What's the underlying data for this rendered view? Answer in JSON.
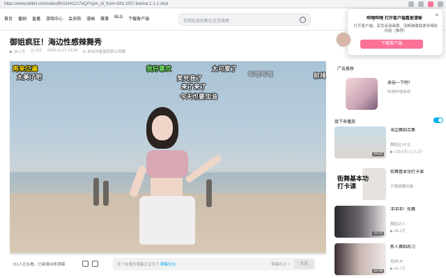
{
  "browser": {
    "url": "https://www.bilibili.com/video/BV1i4411X7eQ/?spm_id_from=333.1007.tianma.1-1-1.click"
  },
  "nav": {
    "items": [
      "首页",
      "番剧",
      "直播",
      "游戏中心",
      "会员购",
      "漫画",
      "赛事",
      "BLG",
      "下载客户端"
    ]
  },
  "search": {
    "placeholder": "你想知道的都在这里搜索"
  },
  "popup": {
    "close": "×",
    "title": "哔哩哔哩 打开客户端看更清晰",
    "desc": "打开客户端，享受高清画质、流畅弹幕和更多精彩内容（推荐）",
    "button": "下载客户端"
  },
  "video": {
    "title": "御姐疯狂！海边性感辣舞秀",
    "meta": [
      "▶ 35.1万",
      "◫ 212",
      "2024-11-17 15:24",
      "⊘ 未经作者授权禁止转载"
    ],
    "danmaku": [
      {
        "text": "再来亿遍",
        "color": "yellow"
      },
      {
        "text": "太美了吧",
        "color": "white"
      },
      {
        "text": "我好喜欢",
        "color": "green"
      },
      {
        "text": "太可爱了",
        "color": "white"
      },
      {
        "text": "笑死我了",
        "color": "white"
      },
      {
        "text": "来了来了",
        "color": "white"
      },
      {
        "text": "今天也要加油",
        "color": "white"
      },
      {
        "text": "哔哩哔哩",
        "color": "faint"
      },
      {
        "text": "前排",
        "color": "white"
      }
    ],
    "progress": 0
  },
  "controls": {
    "watching": "311人正在看，已装填96条弹幕",
    "danmaku_placeholder": "发个友善的弹幕见证当下",
    "danmaku_link": "弹幕礼仪",
    "etiquette": "弹幕礼仪 >",
    "send": "发送"
  },
  "sidebar": {
    "ad_label": "广告推荐",
    "ad_title": "来玩一下吧！",
    "ad_sub": "哔哩哔哩游戏",
    "rec_heading": "接下来播放",
    "autoplay": true,
    "recs": [
      {
        "title": "海边舞蹈合集",
        "up": "舞蹈区UP主",
        "stats": "▶ 128.6万  ◫ 2.1万",
        "duration": "04:32",
        "banner": ""
      },
      {
        "title": "街舞基本功打卡课",
        "up": "不要跳舞的猫",
        "stats": "",
        "duration": "",
        "banner": "街舞基本功\n打卡课"
      },
      {
        "title": "冲冲冲！热舞",
        "up": "舞蹈达人",
        "stats": "▶ 88.3万",
        "duration": "03:15",
        "banner": ""
      },
      {
        "title": "新人舞蹈练习",
        "up": "视频UP",
        "stats": "▶ 42.7万",
        "duration": "02:48",
        "banner": ""
      }
    ]
  }
}
